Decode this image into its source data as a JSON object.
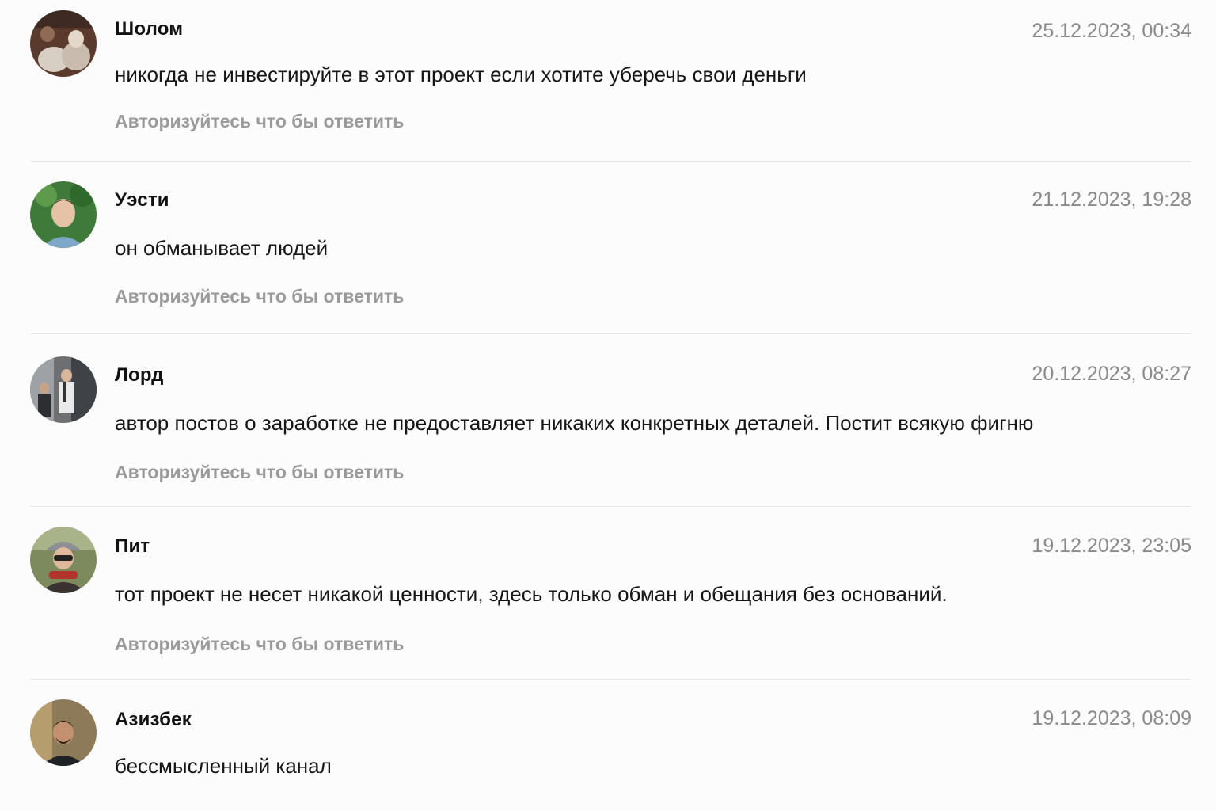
{
  "comments": [
    {
      "author": "Шолом",
      "date": "25.12.2023, 00:34",
      "text": "никогда не инвестируйте в этот проект если хотите уберечь свои деньги",
      "reply": "Авторизуйтесь что бы ответить"
    },
    {
      "author": "Уэсти",
      "date": "21.12.2023, 19:28",
      "text": "он обманывает людей",
      "reply": "Авторизуйтесь что бы ответить"
    },
    {
      "author": "Лорд",
      "date": "20.12.2023, 08:27",
      "text": "автор постов о заработке не предоставляет никаких конкретных деталей. Постит всякую фигню",
      "reply": "Авторизуйтесь что бы ответить"
    },
    {
      "author": "Пит",
      "date": "19.12.2023, 23:05",
      "text": "тот проект не несет никакой ценности, здесь только обман и обещания без оснований.",
      "reply": "Авторизуйтесь что бы ответить"
    },
    {
      "author": "Азизбек",
      "date": "19.12.2023, 08:09",
      "text": "бессмысленный канал"
    }
  ]
}
